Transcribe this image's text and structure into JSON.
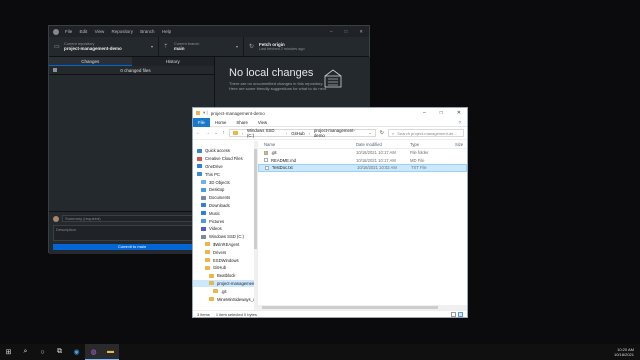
{
  "github": {
    "menu": [
      "File",
      "Edit",
      "View",
      "Repository",
      "Branch",
      "Help"
    ],
    "current_repo_label": "Current repository",
    "current_repo": "project-management-demo",
    "current_branch_label": "Current branch",
    "current_branch": "main",
    "fetch_label": "Fetch origin",
    "fetch_sub": "Last fetched 2 minutes ago",
    "tab_changes": "Changes",
    "tab_history": "History",
    "changed_files": "0 changed files",
    "summary_placeholder": "Summary (required)",
    "description_placeholder": "Description",
    "commit_button": "Commit to main",
    "empty_title": "No local changes",
    "empty_line1": "There are no uncommitted changes in this repository.",
    "empty_line2": "Here are some friendly suggestions for what to do next."
  },
  "explorer": {
    "title": "project-management-demo",
    "ribbon": {
      "file": "File",
      "home": "Home",
      "share": "Share",
      "view": "View"
    },
    "path": [
      "Windows SSD (C:)",
      "GitHub",
      "project-management-demo"
    ],
    "search_placeholder": "Search project-management-de...",
    "nav": [
      {
        "label": "Quick access",
        "icon": "star-icon",
        "color": "#3b82d6",
        "indent": 0
      },
      {
        "label": "Creative Cloud Files",
        "icon": "cloud-icon",
        "color": "#d9534f",
        "indent": 0
      },
      {
        "label": "OneDrive",
        "icon": "cloud-icon",
        "color": "#2f7fd8",
        "indent": 0
      },
      {
        "label": "This PC",
        "icon": "pc-icon",
        "color": "#3b8ad6",
        "indent": 0
      },
      {
        "label": "3D Objects",
        "icon": "folder-icon",
        "color": "#6fb3e6",
        "indent": 1
      },
      {
        "label": "Desktop",
        "icon": "folder-icon",
        "color": "#4a9de0",
        "indent": 1
      },
      {
        "label": "Documents",
        "icon": "folder-icon",
        "color": "#7d8a99",
        "indent": 1
      },
      {
        "label": "Downloads",
        "icon": "folder-icon",
        "color": "#2f7fd8",
        "indent": 1
      },
      {
        "label": "Music",
        "icon": "folder-icon",
        "color": "#2f7fd8",
        "indent": 1
      },
      {
        "label": "Pictures",
        "icon": "folder-icon",
        "color": "#4a9de0",
        "indent": 1
      },
      {
        "label": "Videos",
        "icon": "folder-icon",
        "color": "#4a5fd0",
        "indent": 1
      },
      {
        "label": "Windows SSD (C:)",
        "icon": "drive-icon",
        "color": "#7d8a99",
        "indent": 1
      },
      {
        "label": "$WinREAgent",
        "icon": "folder-icon",
        "color": "#e8b84a",
        "indent": 2
      },
      {
        "label": "Drivers",
        "icon": "folder-icon",
        "color": "#e8b84a",
        "indent": 2
      },
      {
        "label": "ESDWindows",
        "icon": "folder-icon",
        "color": "#e8b84a",
        "indent": 2
      },
      {
        "label": "GitHub",
        "icon": "folder-icon",
        "color": "#e8b84a",
        "indent": 2
      },
      {
        "label": "Beatblock",
        "icon": "folder-icon",
        "color": "#e8b84a",
        "indent": 3
      },
      {
        "label": "project-management",
        "icon": "folder-icon",
        "color": "#e8b84a",
        "indent": 3,
        "selected": true
      },
      {
        "label": ".git",
        "icon": "folder-icon",
        "color": "#e8b84a",
        "indent": 4
      },
      {
        "label": "MineMinSideways_d...",
        "icon": "folder-icon",
        "color": "#e8b84a",
        "indent": 3
      }
    ],
    "columns": {
      "name": "Name",
      "date": "Date modified",
      "type": "Type",
      "size": "Size"
    },
    "files": [
      {
        "name": ".git",
        "date": "10/18/2021 10:17 AM",
        "type": "File folder",
        "icon": "folder-icon",
        "color": "#e8b84a"
      },
      {
        "name": "README.md",
        "date": "10/18/2021 10:17 AM",
        "type": "MD File",
        "icon": "file-icon",
        "color": "#ffffff"
      },
      {
        "name": "TestDoc.txt",
        "date": "10/18/2021 10:02 AM",
        "type": "TXT File",
        "icon": "file-icon",
        "color": "#ffffff",
        "selected": true
      }
    ],
    "status": {
      "items": "3 items",
      "selected": "1 item selected  0 bytes"
    }
  },
  "taskbar": {
    "time": "10:20 AM",
    "date": "10/18/2021"
  }
}
